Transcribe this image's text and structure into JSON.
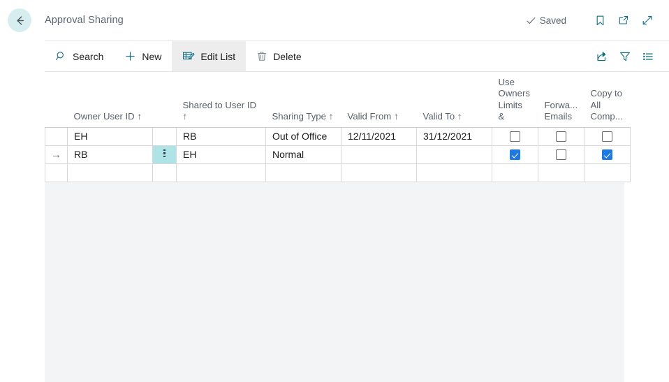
{
  "header": {
    "back_icon": "arrow-left-icon",
    "title": "Approval Sharing",
    "status_label": "Saved",
    "status_icon": "checkmark-icon",
    "actions": [
      {
        "name": "bookmark-icon",
        "label": "Bookmark"
      },
      {
        "name": "open-in-new-window-icon",
        "label": "Open in new window"
      },
      {
        "name": "expand-icon",
        "label": "Expand"
      }
    ]
  },
  "toolbar": {
    "search_label": "Search",
    "new_label": "New",
    "edit_list_label": "Edit List",
    "delete_label": "Delete",
    "search_icon": "search-icon",
    "new_icon": "plus-icon",
    "edit_list_icon": "edit-list-icon",
    "delete_icon": "trash-icon",
    "right_actions": [
      {
        "name": "share-icon",
        "label": "Share"
      },
      {
        "name": "filter-icon",
        "label": "Filter"
      },
      {
        "name": "list-options-icon",
        "label": "List options"
      }
    ]
  },
  "grid": {
    "columns": [
      {
        "key": "indicator",
        "label": "",
        "sorted": false
      },
      {
        "key": "owner_user_id",
        "label": "Owner User ID",
        "sort_arrow": "↑"
      },
      {
        "key": "dots",
        "label": "",
        "sorted": false
      },
      {
        "key": "shared_to_user_id",
        "label": "Shared to User ID",
        "sort_arrow": "↑"
      },
      {
        "key": "sharing_type",
        "label": "Sharing Type",
        "sort_arrow": "↑"
      },
      {
        "key": "valid_from",
        "label": "Valid From",
        "sort_arrow": "↑"
      },
      {
        "key": "valid_to",
        "label": "Valid To",
        "sort_arrow": "↑"
      },
      {
        "key": "use_owners_limits",
        "label": "Use Owners Limits &",
        "sort_arrow": ""
      },
      {
        "key": "forward_emails",
        "label": "Forwa... Emails",
        "sort_arrow": ""
      },
      {
        "key": "copy_to_all_comp",
        "label": "Copy to All Comp...",
        "sort_arrow": ""
      }
    ],
    "header_text": {
      "owner_user_id": "Owner User ID ↑",
      "shared_to_user_id_l1": "Shared to User ID",
      "shared_to_user_id_l2": "↑",
      "sharing_type": "Sharing Type ↑",
      "valid_from": "Valid From ↑",
      "valid_to": "Valid To ↑",
      "use_owners_l1": "Use",
      "use_owners_l2": "Owners",
      "use_owners_l3": "Limits",
      "use_owners_l4": "&",
      "forward_l1": "Forwa...",
      "forward_l2": "Emails",
      "copy_l1": "Copy to",
      "copy_l2": "All",
      "copy_l3": "Comp..."
    },
    "rows": [
      {
        "selected": false,
        "indicator": "",
        "owner_user_id": "EH",
        "dots": "",
        "shared_to_user_id": "RB",
        "sharing_type": "Out of Office",
        "valid_from": "12/11/2021",
        "valid_to": "31/12/2021",
        "use_owners_limits": false,
        "forward_emails": false,
        "copy_to_all_comp": false
      },
      {
        "selected": true,
        "indicator": "→",
        "owner_user_id": "RB",
        "dots": "⋮",
        "shared_to_user_id": "EH",
        "sharing_type": "Normal",
        "valid_from": "",
        "valid_to": "",
        "use_owners_limits": true,
        "forward_emails": false,
        "copy_to_all_comp": true
      },
      {
        "selected": false,
        "indicator": "",
        "owner_user_id": "",
        "dots": "",
        "shared_to_user_id": "",
        "sharing_type": "",
        "valid_from": "",
        "valid_to": "",
        "use_owners_limits": null,
        "forward_emails": null,
        "copy_to_all_comp": null
      }
    ]
  },
  "colors": {
    "accent_teal": "#0f6e84",
    "back_circle": "#d7eef0",
    "selected_cell": "#aee3e8",
    "checkbox_on": "#1f7ae0",
    "page_bg": "#f3f4f6"
  }
}
